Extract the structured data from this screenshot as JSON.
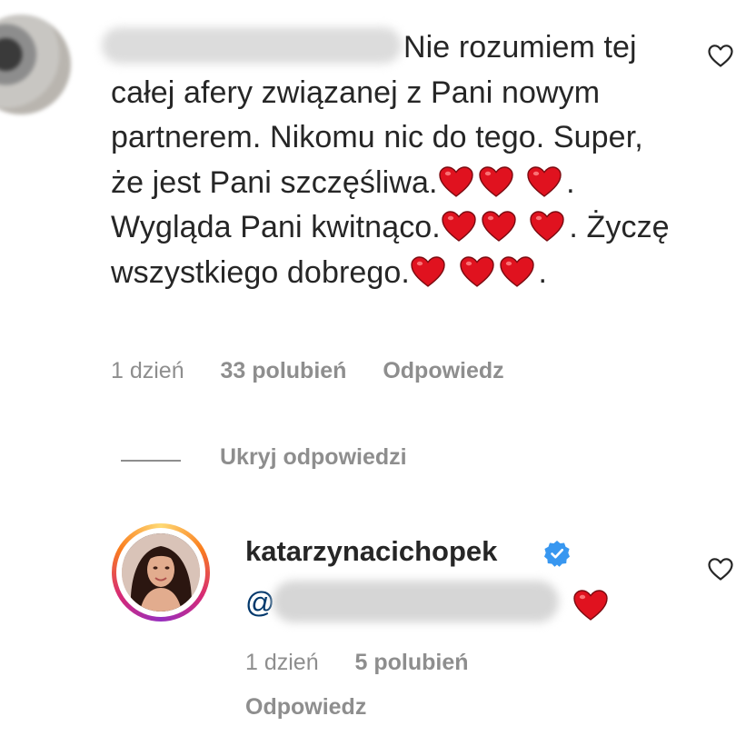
{
  "comment": {
    "text_lead": "Nie rozumiem tej",
    "text_body": "całej afery związanej z Pani nowym partnerem. Nikomu nic do tego. Super, że jest Pani szczęśliwa.",
    "sentence_2": ". Wygląda Pani kwitnąco.",
    "sentence_3": ". Życzę wszystkiego dobrego.",
    "ending": ".",
    "time": "1 dzień",
    "likes": "33 polubień",
    "reply_label": "Odpowiedz"
  },
  "replies_toggle": "Ukryj odpowiedzi",
  "reply": {
    "username": "katarzynacichopek",
    "mention_prefix": "@",
    "time": "1 dzień",
    "likes": "5 polubień",
    "reply_label": "Odpowiedz"
  },
  "icons": {
    "heart_emoji": "red-heart-emoji",
    "like": "heart-outline-icon",
    "verified": "verified-badge-icon"
  },
  "colors": {
    "text": "#262626",
    "secondary": "#8e8e8e",
    "heart_red": "#e0121f",
    "verified_blue": "#3897f0",
    "mention": "#00376b"
  }
}
